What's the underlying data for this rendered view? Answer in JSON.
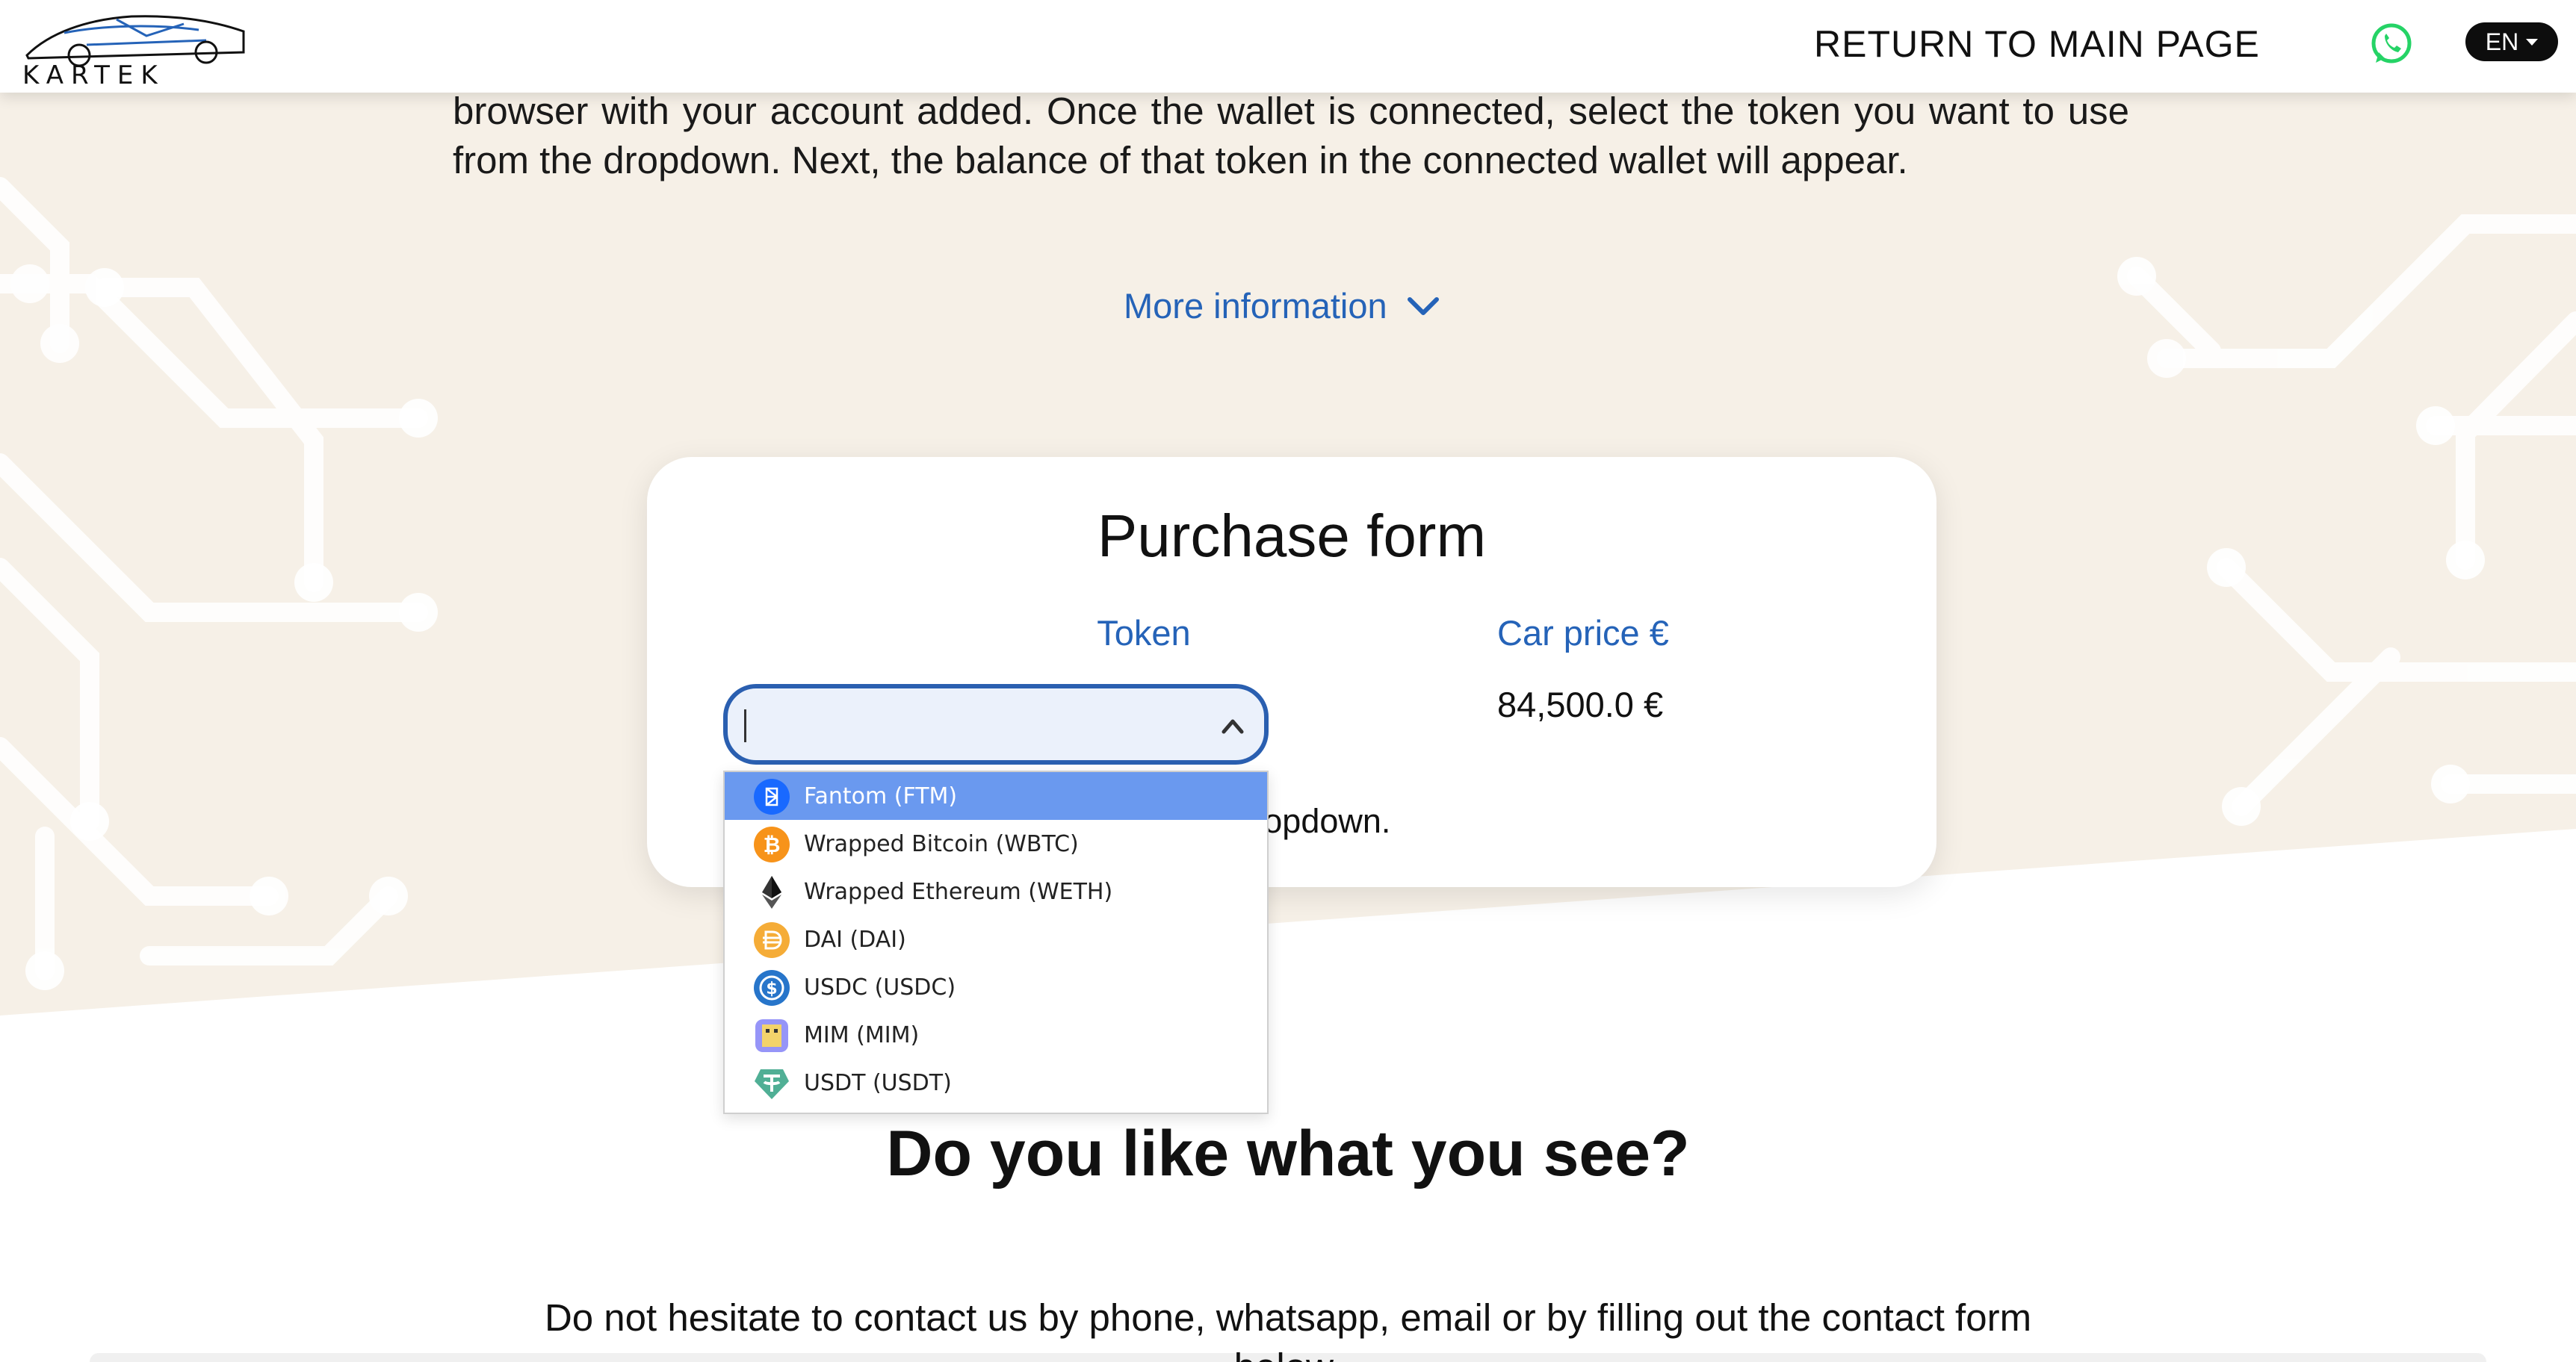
{
  "header": {
    "logo_text": "KARTEK",
    "return_link": "RETURN TO MAIN PAGE",
    "language": "EN"
  },
  "intro": {
    "text": "browser with your account added. Once the wallet is connected, select the token you want to use from the dropdown. Next, the balance of that token in the connected wallet will appear.",
    "more_info": "More information"
  },
  "purchase_form": {
    "title": "Purchase form",
    "token_label": "Token",
    "price_label": "Car price €",
    "price_value": "84,500.0 €",
    "hint_text": "Select a token from the dropdown."
  },
  "token_select": {
    "value": "",
    "options": [
      {
        "label": "Fantom (FTM)",
        "icon": "fantom-icon",
        "color": "#1969ff",
        "highlighted": true
      },
      {
        "label": "Wrapped Bitcoin (WBTC)",
        "icon": "bitcoin-icon",
        "color": "#f7931a",
        "highlighted": false
      },
      {
        "label": "Wrapped Ethereum (WETH)",
        "icon": "ethereum-icon",
        "color": "#343434",
        "highlighted": false
      },
      {
        "label": "DAI (DAI)",
        "icon": "dai-icon",
        "color": "#f5ac37",
        "highlighted": false
      },
      {
        "label": "USDC (USDC)",
        "icon": "usdc-icon",
        "color": "#2775ca",
        "highlighted": false
      },
      {
        "label": "MIM (MIM)",
        "icon": "mim-icon",
        "color": "#9695f8",
        "highlighted": false
      },
      {
        "label": "USDT (USDT)",
        "icon": "usdt-icon",
        "color": "#50af95",
        "highlighted": false
      }
    ]
  },
  "cta": {
    "title": "Do you like what you see?",
    "text": "Do not hesitate to contact us by phone, whatsapp, email or by filling out the contact form below."
  },
  "colors": {
    "accent": "#2563b8",
    "background_beige": "#f6f0e7",
    "highlight": "#6a99ef"
  }
}
